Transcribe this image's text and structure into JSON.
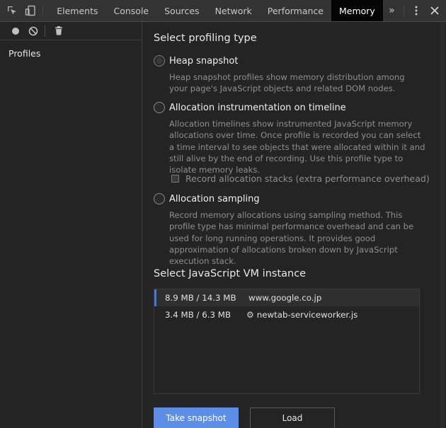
{
  "toolbar": {
    "inspect_icon": "inspect-element-icon",
    "device_icon": "device-toolbar-icon",
    "tabs": [
      "Elements",
      "Console",
      "Sources",
      "Network",
      "Performance",
      "Memory"
    ],
    "active_tab": "Memory",
    "more_tabs": "»",
    "menu_icon": "kebab-menu-icon",
    "close_icon": "close-icon"
  },
  "sidebar": {
    "record_icon": "record-icon",
    "clear_icon": "clear-icon",
    "delete_icon": "trash-icon",
    "section_label": "Profiles"
  },
  "main": {
    "heading": "Select profiling type",
    "options": [
      {
        "title": "Heap snapshot",
        "description": "Heap snapshot profiles show memory distribution among your page's JavaScript objects and related DOM nodes.",
        "selected": true
      },
      {
        "title": "Allocation instrumentation on timeline",
        "description": "Allocation timelines show instrumented JavaScript memory allocations over time. Once profile is recorded you can select a time interval to see objects that were allocated within it and still alive by the end of recording. Use this profile type to isolate memory leaks.",
        "selected": false
      },
      {
        "title": "Allocation sampling",
        "description": "Record memory allocations using sampling method. This profile type has minimal performance overhead and can be used for long running operations. It provides good approximation of allocations broken down by JavaScript execution stack.",
        "selected": false
      }
    ],
    "checkbox_label": "Record allocation stacks (extra performance overhead)",
    "checkbox_checked": false,
    "vm_heading": "Select JavaScript VM instance",
    "vm_instances": [
      {
        "size": "8.9 MB / 14.3 MB",
        "name": "www.google.co.jp",
        "selected": true
      },
      {
        "size": "3.4 MB / 6.3 MB",
        "name": "newtab-serviceworker.js",
        "icon": "gear-icon",
        "selected": false
      }
    ],
    "primary_button": "Take snapshot",
    "secondary_button": "Load"
  },
  "colors": {
    "accent": "#5b8ee6",
    "selection_border": "#4f78c8",
    "background": "#242424",
    "tabbar": "#333333"
  }
}
